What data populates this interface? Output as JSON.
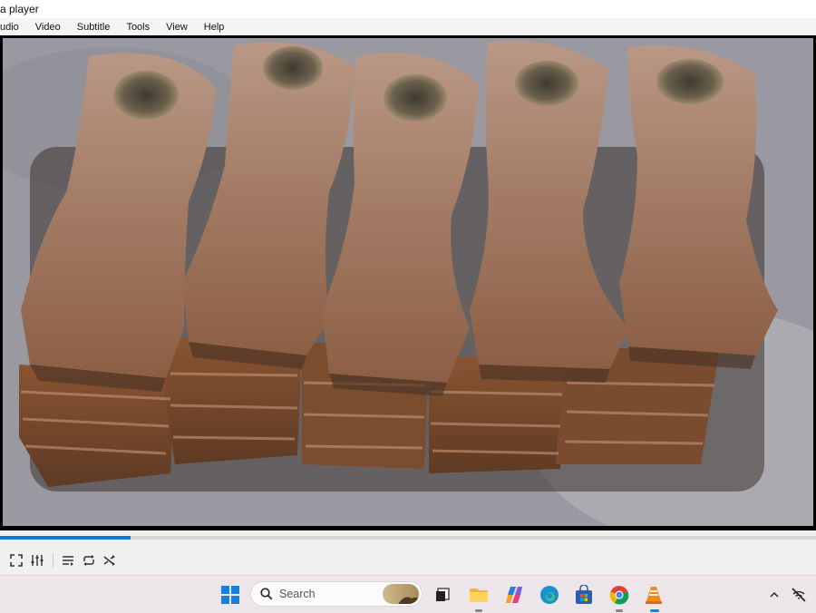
{
  "window": {
    "title": "a player"
  },
  "menu": {
    "items": [
      "udio",
      "Video",
      "Subtitle",
      "Tools",
      "View",
      "Help"
    ]
  },
  "playback": {
    "progress": 0.16
  },
  "taskbar": {
    "search_label": "Search"
  },
  "colors": {
    "seek_fill": "#1b74d8",
    "taskbar_bg": "#ece6ea"
  },
  "icons": {
    "controls": [
      "fullscreen-icon",
      "extended-settings-icon",
      "playlist-icon",
      "loop-icon",
      "shuffle-icon"
    ],
    "taskbar": [
      "windows-start-icon",
      "search-icon",
      "task-view-icon",
      "file-explorer-icon",
      "copilot-icon",
      "edge-icon",
      "microsoft-store-icon",
      "chrome-icon",
      "vlc-icon",
      "chevron-up-icon",
      "network-off-icon"
    ]
  }
}
